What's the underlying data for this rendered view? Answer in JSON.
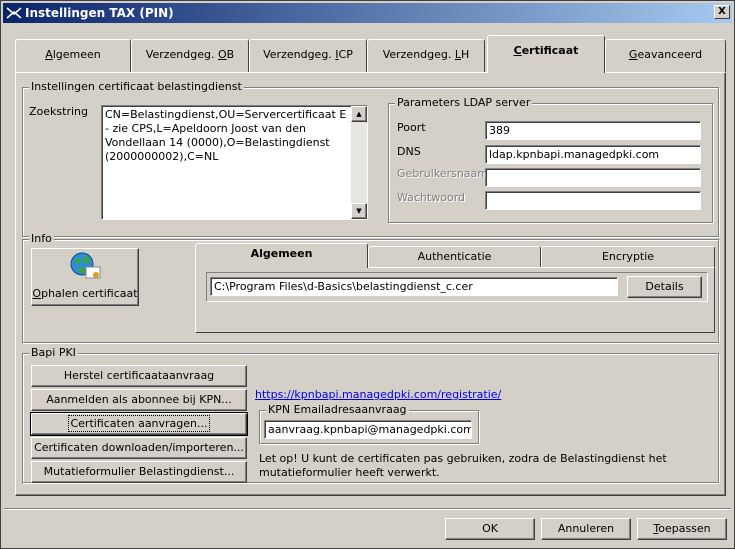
{
  "window": {
    "title": "Instellingen TAX (PIN)",
    "close_label": "X"
  },
  "tabs": [
    {
      "label": "Algemeen",
      "underline": "A",
      "rest": "lgemeen"
    },
    {
      "label": "Verzendgeg. OB",
      "prefix": "Verzendgeg. ",
      "underline": "O",
      "rest": "B"
    },
    {
      "label": "Verzendgeg. ICP",
      "prefix": "Verzendgeg. ",
      "underline": "I",
      "rest": "CP"
    },
    {
      "label": "Verzendgeg. LH",
      "prefix": "Verzendgeg. ",
      "underline": "L",
      "rest": "H"
    },
    {
      "label": "Certificaat",
      "underline": "C",
      "rest": "ertificaat"
    },
    {
      "label": "Geavanceerd",
      "underline": "G",
      "rest": "eavanceerd"
    }
  ],
  "cert_settings": {
    "title": "Instellingen certificaat belastingdienst",
    "search_label": "Zoekstring",
    "search_value": "CN=Belastingdienst,OU=Servercertificaat E - zie CPS,L=Apeldoorn Joost van den Vondellaan 14 (0000),O=Belastingdienst (2000000002),C=NL",
    "ldap": {
      "title": "Parameters LDAP server",
      "port_label": "Poort",
      "port_value": "389",
      "dns_label": "DNS",
      "dns_value": "ldap.kpnbapi.managedpki.com",
      "user_label": "Gebruikersnaam",
      "user_value": "",
      "password_label": "Wachtwoord",
      "password_value": ""
    }
  },
  "info": {
    "title": "Info",
    "fetch_button": "Ophalen certificaat",
    "fetch_underline": "O",
    "fetch_rest": "phalen certificaat",
    "tabs": [
      "Algemeen",
      "Authenticatie",
      "Encryptie"
    ],
    "path_value": "C:\\Program Files\\d-Basics\\belastingdienst_c.cer",
    "details_button": "Details"
  },
  "bapi": {
    "title": "Bapi PKI",
    "buttons": [
      "Herstel certificaataanvraag",
      "Aanmelden als abonnee bij KPN...",
      "Certificaten aanvragen...",
      "Certificaten downloaden/importeren...",
      "Mutatieformulier Belastingdienst..."
    ],
    "link": "https://kpnbapi.managedpki.com/registratie/",
    "email_group_title": "KPN Emailadresaanvraag",
    "email_value": "aanvraag.kpnbapi@managedpki.com",
    "note": "Let op! U kunt de certificaten pas gebruiken, zodra de Belastingdienst het mutatieformulier heeft verwerkt."
  },
  "footer": {
    "ok": "OK",
    "cancel": "Annuleren",
    "apply": "Toepassen",
    "apply_underline": "T",
    "apply_rest": "oepassen"
  }
}
